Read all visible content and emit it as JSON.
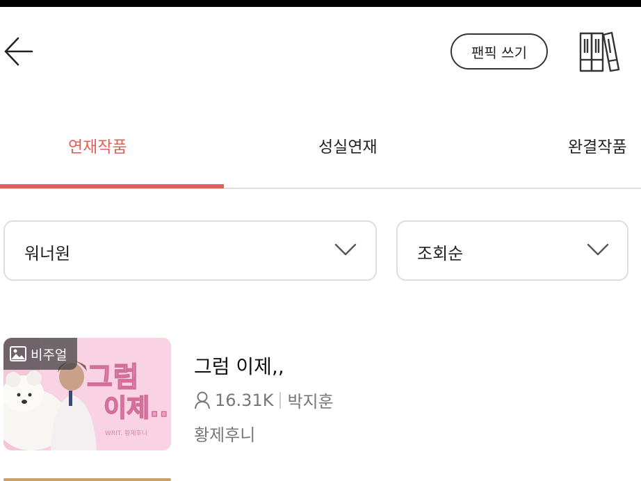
{
  "header": {
    "write_label": "팬픽 쓰기",
    "back_icon": "arrow-left-icon",
    "library_icon": "bookshelf-icon"
  },
  "tabs": [
    {
      "label": "연재작품",
      "active": true
    },
    {
      "label": "성실연재",
      "active": false
    },
    {
      "label": "완결작품",
      "active": false
    }
  ],
  "filters": {
    "group": {
      "value": "워너원",
      "icon": "chevron-down-icon"
    },
    "sort": {
      "value": "조회순",
      "icon": "chevron-down-icon"
    }
  },
  "items": [
    {
      "badge": "비주얼",
      "title": "그럼 이제,,",
      "views": "16.31K",
      "tag": "박지훈",
      "author": "황제후니",
      "thumb_text_line1": "그럼",
      "thumb_text_line2": "이제..",
      "thumb_caption": "WRIT. 황제후니"
    }
  ],
  "colors": {
    "accent": "#e0615a",
    "text": "#222222",
    "muted": "#777777",
    "border": "#dddddd"
  }
}
